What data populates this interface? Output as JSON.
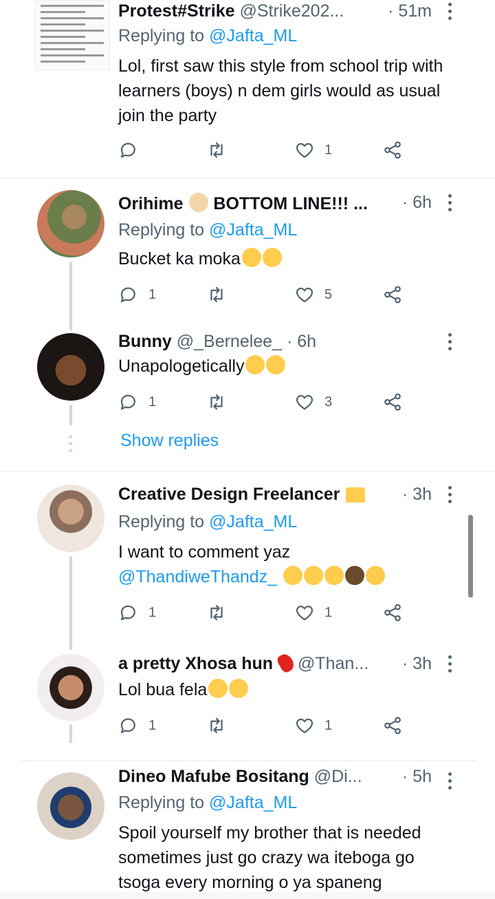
{
  "tweets": [
    {
      "name": "Protest#Strike",
      "handle": "@Strike202...",
      "time": "· 51m",
      "reply_prefix": "Replying to",
      "reply_to": "@Jafta_ML",
      "text": "Lol, first saw this style from school trip with learners (boys) n dem girls would as usual join the party",
      "replies": "",
      "likes": "1"
    },
    {
      "name": "Orihime",
      "name_suffix": "BOTTOM LINE!!! ...",
      "time": "· 6h",
      "reply_prefix": "Replying to",
      "reply_to": "@Jafta_ML",
      "text": "Bucket ka moka",
      "replies": "1",
      "likes": "5"
    },
    {
      "name": "Bunny",
      "handle": "@_Bernelee_",
      "time": "· 6h",
      "text": "Unapologetically",
      "replies": "1",
      "likes": "3"
    },
    {
      "name": "Creative Design Freelancer",
      "time": "· 3h",
      "reply_prefix": "Replying to",
      "reply_to": "@Jafta_ML",
      "text": "I want to comment yaz",
      "mention": "@ThandiweThandz_",
      "replies": "1",
      "likes": "1"
    },
    {
      "name": "a pretty Xhosa hun",
      "handle": "@Than...",
      "time": "· 3h",
      "text": "Lol bua fela",
      "replies": "1",
      "likes": "1"
    },
    {
      "name": "Dineo Mafube Bositang",
      "handle": "@Di...",
      "time": "· 5h",
      "reply_prefix": "Replying to",
      "reply_to": "@Jafta_ML",
      "text": "Spoil yourself my brother that is needed sometimes just go crazy wa iteboga go tsoga every morning o ya spaneng"
    }
  ],
  "show_replies": "Show replies",
  "colors": {
    "link": "#1d9bf0",
    "muted": "#536471",
    "text": "#0f1419"
  },
  "icons": [
    "reply-icon",
    "retweet-icon",
    "like-icon",
    "share-icon",
    "more-icon"
  ]
}
